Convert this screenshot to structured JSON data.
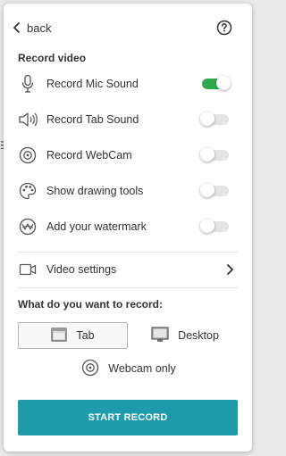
{
  "header": {
    "back_label": "back"
  },
  "record_video": {
    "title": "Record video",
    "options": [
      {
        "label": "Record Mic Sound",
        "icon": "microphone-icon",
        "enabled": true
      },
      {
        "label": "Record Tab Sound",
        "icon": "speaker-icon",
        "enabled": false
      },
      {
        "label": "Record WebCam",
        "icon": "webcam-icon",
        "enabled": false
      },
      {
        "label": "Show drawing tools",
        "icon": "palette-icon",
        "enabled": false
      },
      {
        "label": "Add your watermark",
        "icon": "watermark-icon",
        "enabled": false
      }
    ],
    "video_settings_label": "Video settings"
  },
  "record_target": {
    "question": "What do you want to record:",
    "tab_label": "Tab",
    "desktop_label": "Desktop",
    "webcam_only_label": "Webcam only",
    "selected": "Tab"
  },
  "start_button_label": "START RECORD",
  "colors": {
    "accent": "#1e9bab",
    "toggle_on": "#2fa84f"
  }
}
